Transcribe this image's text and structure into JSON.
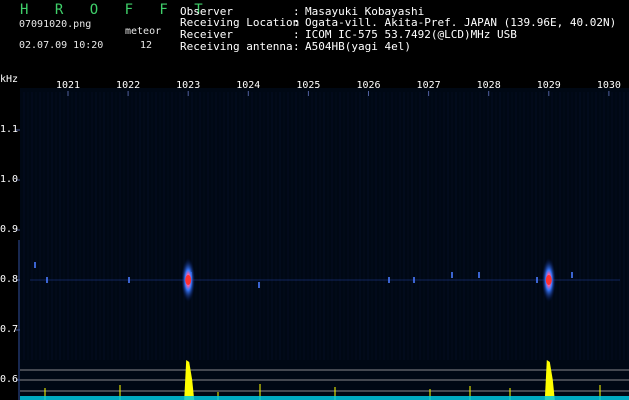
{
  "header": {
    "brand": "H R O F F T",
    "filename": "07091020.png",
    "meteor_label": "meteor",
    "datetime": "02.07.09 10:20",
    "meteor_count": "12",
    "fields": [
      {
        "label": "Observer",
        "value": "Masayuki Kobayashi"
      },
      {
        "label": "Receiving Location",
        "value": "Ogata-vill. Akita-Pref. JAPAN (139.96E, 40.02N)"
      },
      {
        "label": "Receiver",
        "value": "ICOM IC-575 53.7492(@LCD)MHz USB"
      },
      {
        "label": "Receiving antenna",
        "value": "A504HB(yagi 4el)"
      }
    ]
  },
  "axes": {
    "y_unit": "kHz",
    "x_ticks": [
      "1021",
      "1022",
      "1023",
      "1024",
      "1025",
      "1026",
      "1027",
      "1028",
      "1029",
      "1030"
    ],
    "y_ticks": [
      "1.1",
      "1.0",
      "0.9",
      "0.8",
      "0.7",
      "0.6"
    ]
  },
  "colors": {
    "background": "#000000",
    "signal_core": "#ff3030",
    "signal_glow": "#2a6cff",
    "bar": "#ffff00",
    "baseline": "#00c8e0",
    "brand": "#3fd06a"
  },
  "chart_data": {
    "type": "spectrogram",
    "x_unit": "time (minute index)",
    "y_unit": "kHz",
    "xlim": [
      1020.6,
      1030.2
    ],
    "ylim": [
      0.58,
      1.2
    ],
    "meteor_echoes": [
      {
        "x": 1023.0,
        "y": 0.8,
        "strength": "strong"
      },
      {
        "x": 1029.0,
        "y": 0.8,
        "strength": "strong"
      }
    ],
    "meteor_count": 12
  }
}
